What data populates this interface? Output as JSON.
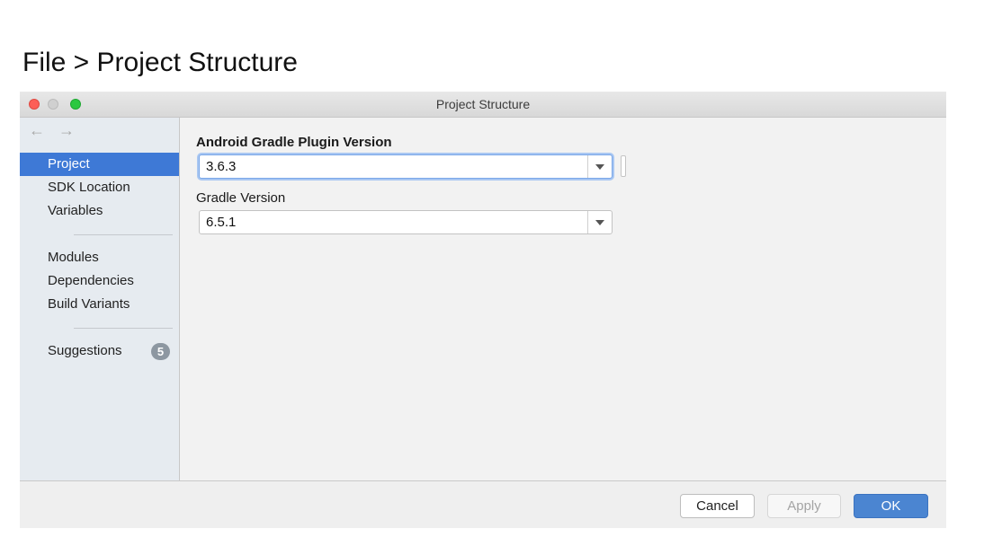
{
  "caption": "File > Project Structure",
  "window": {
    "title": "Project Structure"
  },
  "nav": {
    "back": "←",
    "forward": "→"
  },
  "sidebar": {
    "items": [
      {
        "label": "Project",
        "selected": true
      },
      {
        "label": "SDK Location"
      },
      {
        "label": "Variables"
      },
      {
        "label": "Modules"
      },
      {
        "label": "Dependencies"
      },
      {
        "label": "Build Variants"
      },
      {
        "label": "Suggestions",
        "badge": "5"
      }
    ]
  },
  "main": {
    "agp_label": "Android Gradle Plugin Version",
    "agp_value": "3.6.3",
    "gradle_label": "Gradle Version",
    "gradle_value": "6.5.1"
  },
  "buttons": {
    "cancel": "Cancel",
    "apply": "Apply",
    "ok": "OK"
  },
  "colors": {
    "accent": "#3e79d6",
    "ok_button": "#4b85d1",
    "sidebar_bg": "#e6ebf0",
    "badge": "#8d97a1"
  }
}
